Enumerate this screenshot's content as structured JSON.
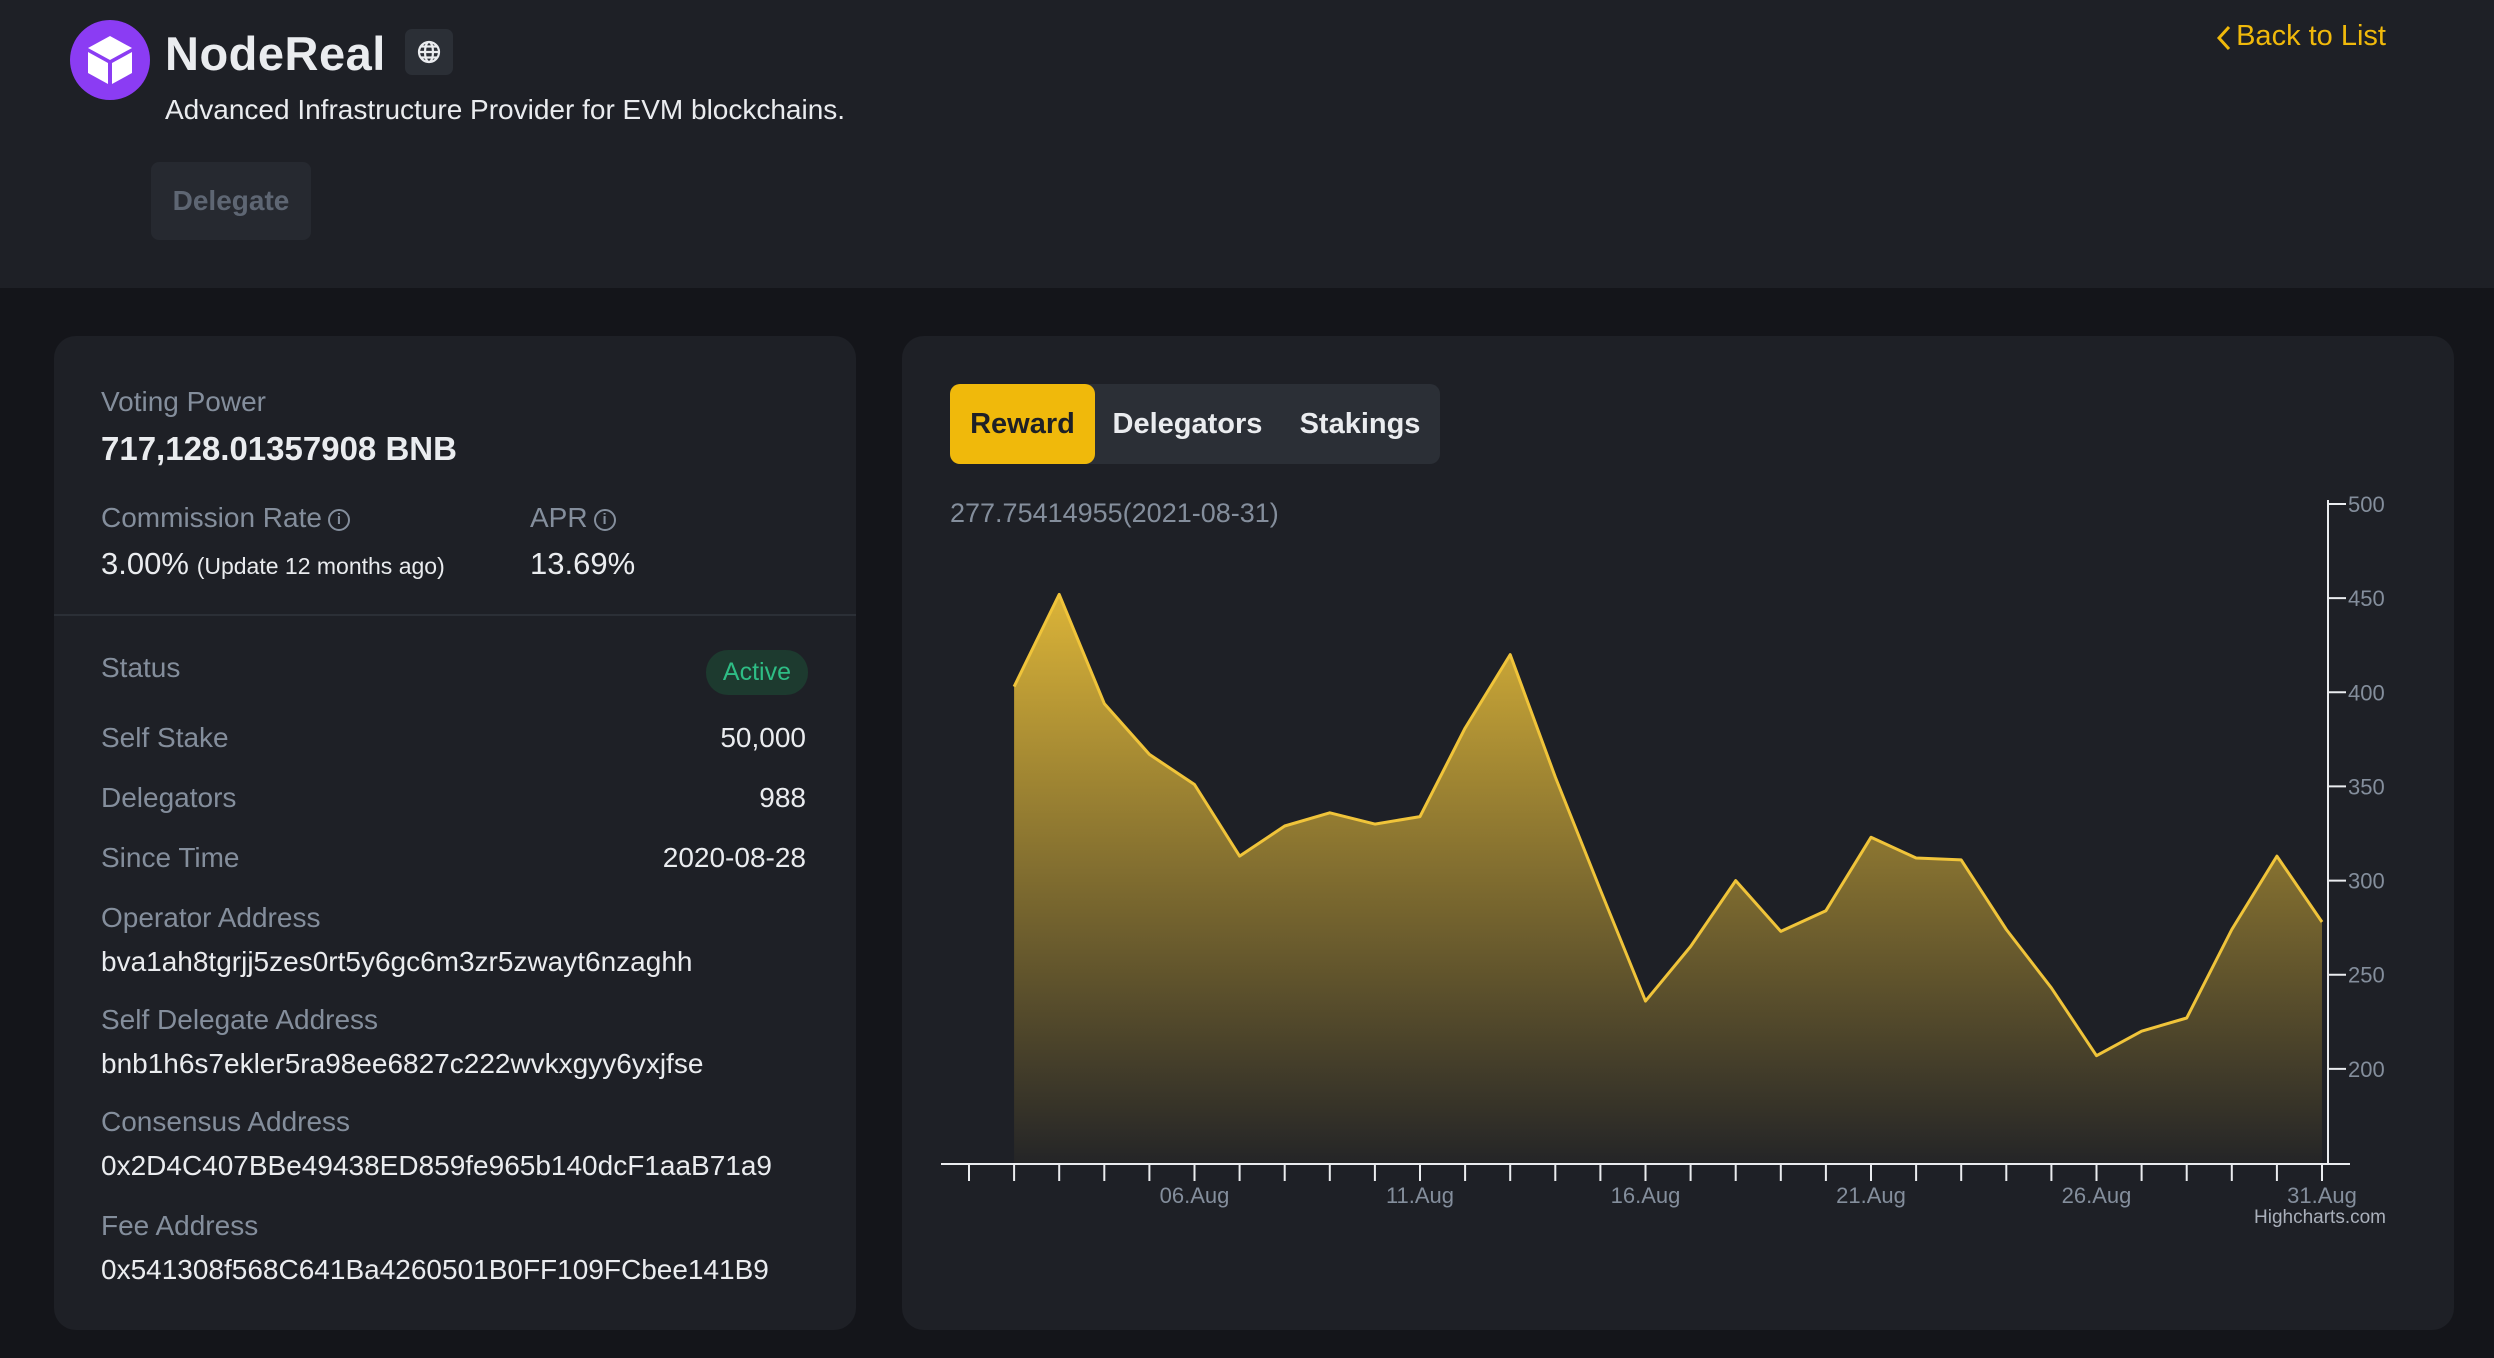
{
  "header": {
    "name": "NodeReal",
    "subtitle": "Advanced Infrastructure Provider for EVM blockchains.",
    "delegate_label": "Delegate",
    "back_label": "Back to List",
    "logo_icon": "cube-icon",
    "website_icon": "globe-icon"
  },
  "stats": {
    "voting_power_label": "Voting Power",
    "voting_power_value": "717,128.01357908 BNB",
    "commission_label": "Commission Rate",
    "commission_value": "3.00%",
    "commission_note": "(Update 12 months ago)",
    "apr_label": "APR",
    "apr_value": "13.69%",
    "info_glyph": "i",
    "status_label": "Status",
    "status_value": "Active",
    "self_stake_label": "Self Stake",
    "self_stake_value": "50,000",
    "delegators_label": "Delegators",
    "delegators_value": "988",
    "since_label": "Since Time",
    "since_value": "2020-08-28",
    "operator_label": "Operator Address",
    "operator_value": "bva1ah8tgrjj5zes0rt5y6gc6m3zr5zwayt6nzaghh",
    "self_delegate_label": "Self Delegate Address",
    "self_delegate_value": "bnb1h6s7ekler5ra98ee6827c222wvkxgyy6yxjfse",
    "consensus_label": "Consensus Address",
    "consensus_value": "0x2D4C407BBe49438ED859fe965b140dcF1aaB71a9",
    "fee_label": "Fee Address",
    "fee_value": "0x541308f568C641Ba4260501B0FF109FCbee141B9"
  },
  "tabs": [
    {
      "label": "Reward",
      "active": true
    },
    {
      "label": "Delegators",
      "active": false
    },
    {
      "label": "Stakings",
      "active": false
    }
  ],
  "chart_tooltip": "277.75414955(2021-08-31)",
  "colors": {
    "accent": "#f0b90b",
    "line": "#f0c43a",
    "positive": "#2ebd85",
    "muted": "#848e9c",
    "logo": "#8b3cf3"
  },
  "chart_data": {
    "type": "area",
    "credits": "Highcharts.com",
    "x": [
      "2021-08-02",
      "2021-08-03",
      "2021-08-04",
      "2021-08-05",
      "2021-08-06",
      "2021-08-07",
      "2021-08-08",
      "2021-08-09",
      "2021-08-10",
      "2021-08-11",
      "2021-08-12",
      "2021-08-13",
      "2021-08-14",
      "2021-08-15",
      "2021-08-16",
      "2021-08-17",
      "2021-08-18",
      "2021-08-19",
      "2021-08-20",
      "2021-08-21",
      "2021-08-22",
      "2021-08-23",
      "2021-08-24",
      "2021-08-25",
      "2021-08-26",
      "2021-08-27",
      "2021-08-28",
      "2021-08-29",
      "2021-08-30",
      "2021-08-31"
    ],
    "values": [
      403,
      452,
      394,
      367,
      351,
      313,
      329,
      336,
      330,
      334,
      381,
      420,
      355,
      295,
      236,
      265,
      300,
      273,
      284,
      323,
      312,
      311,
      274,
      243,
      207,
      220,
      227,
      274,
      313,
      278
    ],
    "x_tick_labels": [
      "06.Aug",
      "11.Aug",
      "16.Aug",
      "21.Aug",
      "26.Aug",
      "31.Aug"
    ],
    "x_tick_dates": [
      "2021-08-06",
      "2021-08-11",
      "2021-08-16",
      "2021-08-21",
      "2021-08-26",
      "2021-08-31"
    ],
    "x_range": [
      "2021-08-01",
      "2021-08-31"
    ],
    "y_ticks": [
      200,
      250,
      300,
      350,
      400,
      450,
      500
    ],
    "y_range": [
      150,
      500
    ],
    "y_axis_side": "right",
    "grid": false,
    "legend": false
  }
}
